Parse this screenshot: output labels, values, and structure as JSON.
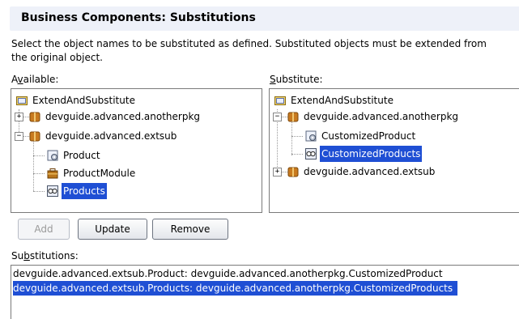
{
  "header": {
    "title": "Business Components: Substitutions"
  },
  "description": {
    "line1": "Select the object names to be substituted as defined. Substituted objects must be extended from",
    "line2": "the original object."
  },
  "available": {
    "label_pre": "A",
    "label_mn": "v",
    "label_post": "ailable:",
    "nodes": [
      {
        "label": "ExtendAndSubstitute"
      },
      {
        "label": "devguide.advanced.anotherpkg"
      },
      {
        "label": "devguide.advanced.extsub"
      },
      {
        "label": "Product"
      },
      {
        "label": "ProductModule"
      },
      {
        "label": "Products"
      }
    ]
  },
  "substitute": {
    "label_mn": "S",
    "label_post": "ubstitute:",
    "nodes": [
      {
        "label": "ExtendAndSubstitute"
      },
      {
        "label": "devguide.advanced.anotherpkg"
      },
      {
        "label": "CustomizedProduct"
      },
      {
        "label": "CustomizedProducts"
      },
      {
        "label": "devguide.advanced.extsub"
      }
    ]
  },
  "buttons": {
    "add": "Add",
    "update": "Update",
    "remove": "Remove"
  },
  "substitutions": {
    "label_pre": "Su",
    "label_mn": "b",
    "label_post": "stitutions:",
    "rows": [
      "devguide.advanced.extsub.Product: devguide.advanced.anotherpkg.CustomizedProduct",
      "devguide.advanced.extsub.Products: devguide.advanced.anotherpkg.CustomizedProducts"
    ]
  },
  "colors": {
    "selection": "#1f4fd4",
    "header_bg": "#eef1f9"
  },
  "icons": [
    "folder-icon",
    "package-icon",
    "entity-object-icon",
    "application-module-icon",
    "view-object-icon"
  ]
}
